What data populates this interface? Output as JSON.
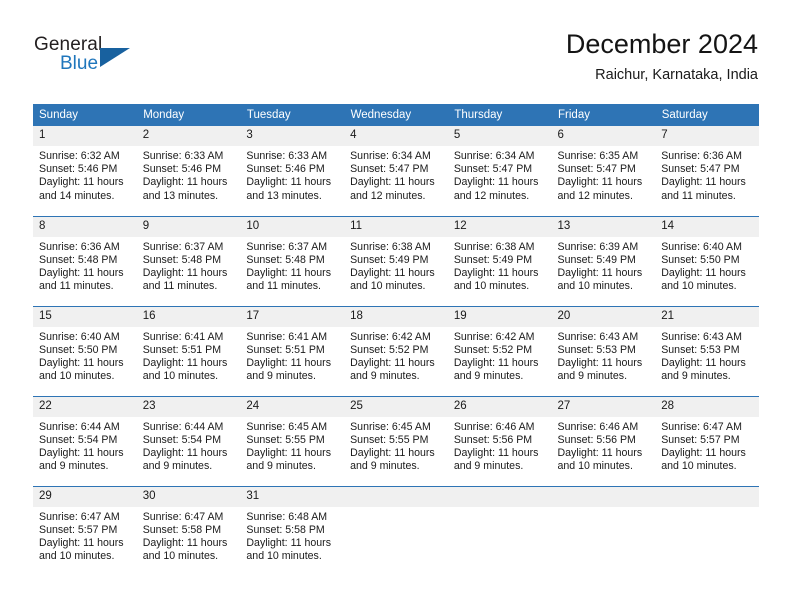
{
  "brand": {
    "name_part1": "General",
    "name_part2": "Blue",
    "accent_color": "#1f76bc",
    "triangle_color": "#18619f"
  },
  "header": {
    "title": "December 2024",
    "subtitle": "Raichur, Karnataka, India"
  },
  "calendar": {
    "header_bg": "#2e74b5",
    "daynum_bg": "#f0f0f0",
    "weekdays": [
      "Sunday",
      "Monday",
      "Tuesday",
      "Wednesday",
      "Thursday",
      "Friday",
      "Saturday"
    ],
    "weeks": [
      [
        {
          "day": "1",
          "sunrise": "Sunrise: 6:32 AM",
          "sunset": "Sunset: 5:46 PM",
          "daylight1": "Daylight: 11 hours",
          "daylight2": "and 14 minutes."
        },
        {
          "day": "2",
          "sunrise": "Sunrise: 6:33 AM",
          "sunset": "Sunset: 5:46 PM",
          "daylight1": "Daylight: 11 hours",
          "daylight2": "and 13 minutes."
        },
        {
          "day": "3",
          "sunrise": "Sunrise: 6:33 AM",
          "sunset": "Sunset: 5:46 PM",
          "daylight1": "Daylight: 11 hours",
          "daylight2": "and 13 minutes."
        },
        {
          "day": "4",
          "sunrise": "Sunrise: 6:34 AM",
          "sunset": "Sunset: 5:47 PM",
          "daylight1": "Daylight: 11 hours",
          "daylight2": "and 12 minutes."
        },
        {
          "day": "5",
          "sunrise": "Sunrise: 6:34 AM",
          "sunset": "Sunset: 5:47 PM",
          "daylight1": "Daylight: 11 hours",
          "daylight2": "and 12 minutes."
        },
        {
          "day": "6",
          "sunrise": "Sunrise: 6:35 AM",
          "sunset": "Sunset: 5:47 PM",
          "daylight1": "Daylight: 11 hours",
          "daylight2": "and 12 minutes."
        },
        {
          "day": "7",
          "sunrise": "Sunrise: 6:36 AM",
          "sunset": "Sunset: 5:47 PM",
          "daylight1": "Daylight: 11 hours",
          "daylight2": "and 11 minutes."
        }
      ],
      [
        {
          "day": "8",
          "sunrise": "Sunrise: 6:36 AM",
          "sunset": "Sunset: 5:48 PM",
          "daylight1": "Daylight: 11 hours",
          "daylight2": "and 11 minutes."
        },
        {
          "day": "9",
          "sunrise": "Sunrise: 6:37 AM",
          "sunset": "Sunset: 5:48 PM",
          "daylight1": "Daylight: 11 hours",
          "daylight2": "and 11 minutes."
        },
        {
          "day": "10",
          "sunrise": "Sunrise: 6:37 AM",
          "sunset": "Sunset: 5:48 PM",
          "daylight1": "Daylight: 11 hours",
          "daylight2": "and 11 minutes."
        },
        {
          "day": "11",
          "sunrise": "Sunrise: 6:38 AM",
          "sunset": "Sunset: 5:49 PM",
          "daylight1": "Daylight: 11 hours",
          "daylight2": "and 10 minutes."
        },
        {
          "day": "12",
          "sunrise": "Sunrise: 6:38 AM",
          "sunset": "Sunset: 5:49 PM",
          "daylight1": "Daylight: 11 hours",
          "daylight2": "and 10 minutes."
        },
        {
          "day": "13",
          "sunrise": "Sunrise: 6:39 AM",
          "sunset": "Sunset: 5:49 PM",
          "daylight1": "Daylight: 11 hours",
          "daylight2": "and 10 minutes."
        },
        {
          "day": "14",
          "sunrise": "Sunrise: 6:40 AM",
          "sunset": "Sunset: 5:50 PM",
          "daylight1": "Daylight: 11 hours",
          "daylight2": "and 10 minutes."
        }
      ],
      [
        {
          "day": "15",
          "sunrise": "Sunrise: 6:40 AM",
          "sunset": "Sunset: 5:50 PM",
          "daylight1": "Daylight: 11 hours",
          "daylight2": "and 10 minutes."
        },
        {
          "day": "16",
          "sunrise": "Sunrise: 6:41 AM",
          "sunset": "Sunset: 5:51 PM",
          "daylight1": "Daylight: 11 hours",
          "daylight2": "and 10 minutes."
        },
        {
          "day": "17",
          "sunrise": "Sunrise: 6:41 AM",
          "sunset": "Sunset: 5:51 PM",
          "daylight1": "Daylight: 11 hours",
          "daylight2": "and 9 minutes."
        },
        {
          "day": "18",
          "sunrise": "Sunrise: 6:42 AM",
          "sunset": "Sunset: 5:52 PM",
          "daylight1": "Daylight: 11 hours",
          "daylight2": "and 9 minutes."
        },
        {
          "day": "19",
          "sunrise": "Sunrise: 6:42 AM",
          "sunset": "Sunset: 5:52 PM",
          "daylight1": "Daylight: 11 hours",
          "daylight2": "and 9 minutes."
        },
        {
          "day": "20",
          "sunrise": "Sunrise: 6:43 AM",
          "sunset": "Sunset: 5:53 PM",
          "daylight1": "Daylight: 11 hours",
          "daylight2": "and 9 minutes."
        },
        {
          "day": "21",
          "sunrise": "Sunrise: 6:43 AM",
          "sunset": "Sunset: 5:53 PM",
          "daylight1": "Daylight: 11 hours",
          "daylight2": "and 9 minutes."
        }
      ],
      [
        {
          "day": "22",
          "sunrise": "Sunrise: 6:44 AM",
          "sunset": "Sunset: 5:54 PM",
          "daylight1": "Daylight: 11 hours",
          "daylight2": "and 9 minutes."
        },
        {
          "day": "23",
          "sunrise": "Sunrise: 6:44 AM",
          "sunset": "Sunset: 5:54 PM",
          "daylight1": "Daylight: 11 hours",
          "daylight2": "and 9 minutes."
        },
        {
          "day": "24",
          "sunrise": "Sunrise: 6:45 AM",
          "sunset": "Sunset: 5:55 PM",
          "daylight1": "Daylight: 11 hours",
          "daylight2": "and 9 minutes."
        },
        {
          "day": "25",
          "sunrise": "Sunrise: 6:45 AM",
          "sunset": "Sunset: 5:55 PM",
          "daylight1": "Daylight: 11 hours",
          "daylight2": "and 9 minutes."
        },
        {
          "day": "26",
          "sunrise": "Sunrise: 6:46 AM",
          "sunset": "Sunset: 5:56 PM",
          "daylight1": "Daylight: 11 hours",
          "daylight2": "and 9 minutes."
        },
        {
          "day": "27",
          "sunrise": "Sunrise: 6:46 AM",
          "sunset": "Sunset: 5:56 PM",
          "daylight1": "Daylight: 11 hours",
          "daylight2": "and 10 minutes."
        },
        {
          "day": "28",
          "sunrise": "Sunrise: 6:47 AM",
          "sunset": "Sunset: 5:57 PM",
          "daylight1": "Daylight: 11 hours",
          "daylight2": "and 10 minutes."
        }
      ],
      [
        {
          "day": "29",
          "sunrise": "Sunrise: 6:47 AM",
          "sunset": "Sunset: 5:57 PM",
          "daylight1": "Daylight: 11 hours",
          "daylight2": "and 10 minutes."
        },
        {
          "day": "30",
          "sunrise": "Sunrise: 6:47 AM",
          "sunset": "Sunset: 5:58 PM",
          "daylight1": "Daylight: 11 hours",
          "daylight2": "and 10 minutes."
        },
        {
          "day": "31",
          "sunrise": "Sunrise: 6:48 AM",
          "sunset": "Sunset: 5:58 PM",
          "daylight1": "Daylight: 11 hours",
          "daylight2": "and 10 minutes."
        },
        {
          "day": "",
          "sunrise": "",
          "sunset": "",
          "daylight1": "",
          "daylight2": ""
        },
        {
          "day": "",
          "sunrise": "",
          "sunset": "",
          "daylight1": "",
          "daylight2": ""
        },
        {
          "day": "",
          "sunrise": "",
          "sunset": "",
          "daylight1": "",
          "daylight2": ""
        },
        {
          "day": "",
          "sunrise": "",
          "sunset": "",
          "daylight1": "",
          "daylight2": ""
        }
      ]
    ]
  }
}
